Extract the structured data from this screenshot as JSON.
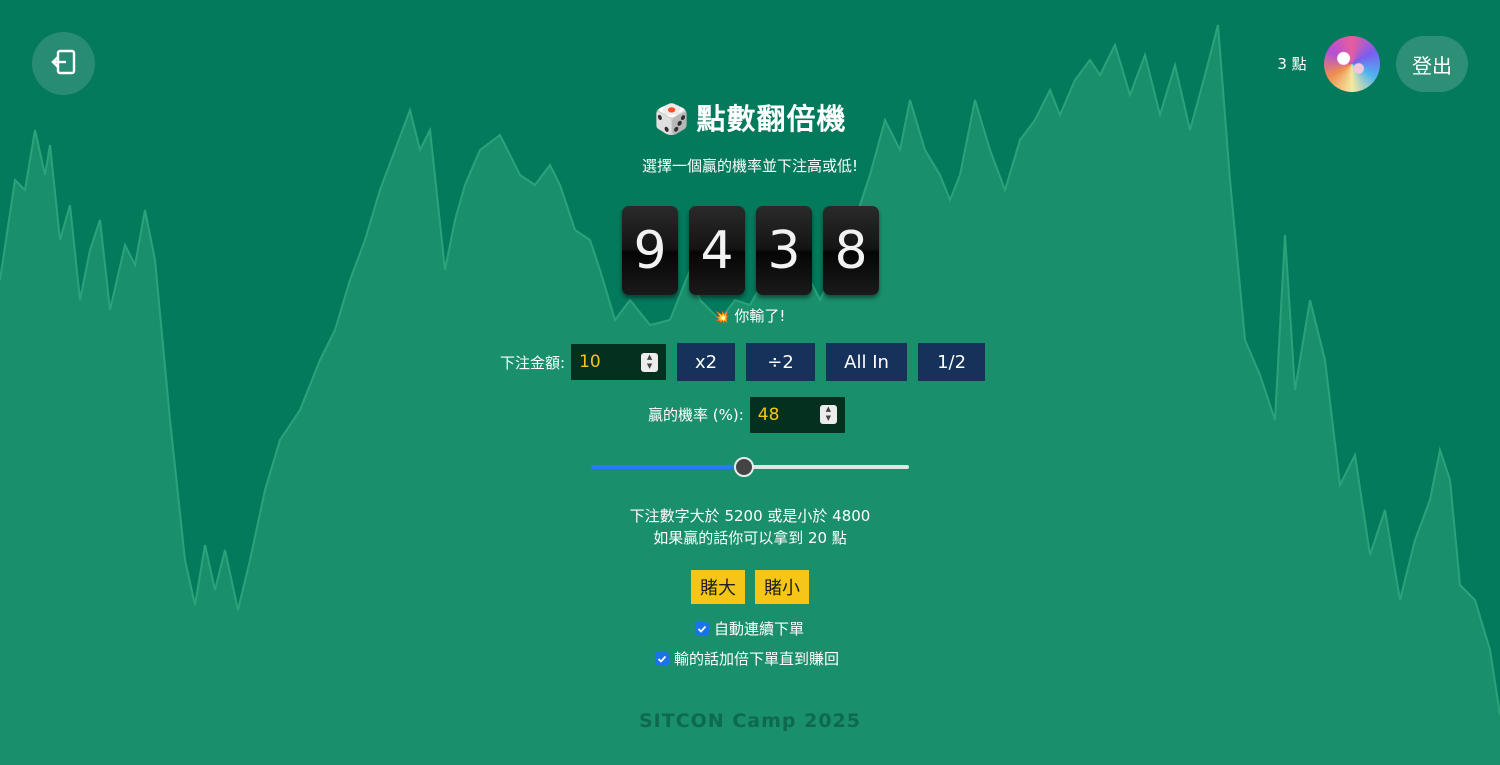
{
  "header": {
    "back_icon": "exit-arrow-icon",
    "points_display": "3 點",
    "avatar_icon": "colorful-user-avatar",
    "logout_label": "登出"
  },
  "game": {
    "title_icon": "🎲",
    "title": "點數翻倍機",
    "subtitle": "選擇一個贏的機率並下注高或低!",
    "digits": [
      "9",
      "4",
      "3",
      "8"
    ],
    "result_icon": "💥",
    "result_text": "你輸了!"
  },
  "bet": {
    "amount_label": "下注金額:",
    "amount_value": "10",
    "double_label": "x2",
    "half_div_label": "÷2",
    "all_in_label": "All In",
    "half_label": "1/2"
  },
  "win": {
    "chance_label": "贏的機率 (%):",
    "chance_value": "48",
    "slider_fraction": 0.48
  },
  "info": {
    "line1": "下注數字大於 5200 或是小於 4800",
    "line2": "如果贏的話你可以拿到 20 點"
  },
  "actions": {
    "bet_high_label": "賭大",
    "bet_low_label": "賭小"
  },
  "options": {
    "auto_bet_label": "自動連續下單",
    "auto_bet_checked": true,
    "martingale_label": "輸的話加倍下單直到賺回",
    "martingale_checked": true
  },
  "footer": {
    "text": "SITCON Camp 2025"
  },
  "colors": {
    "background": "#047a5c",
    "chart_fill": "#1a8f6c",
    "chart_line": "#2aa37b",
    "accent_button": "#16325a",
    "bet_button": "#f5c518",
    "input_bg": "#04301f",
    "input_text": "#f5c518"
  }
}
